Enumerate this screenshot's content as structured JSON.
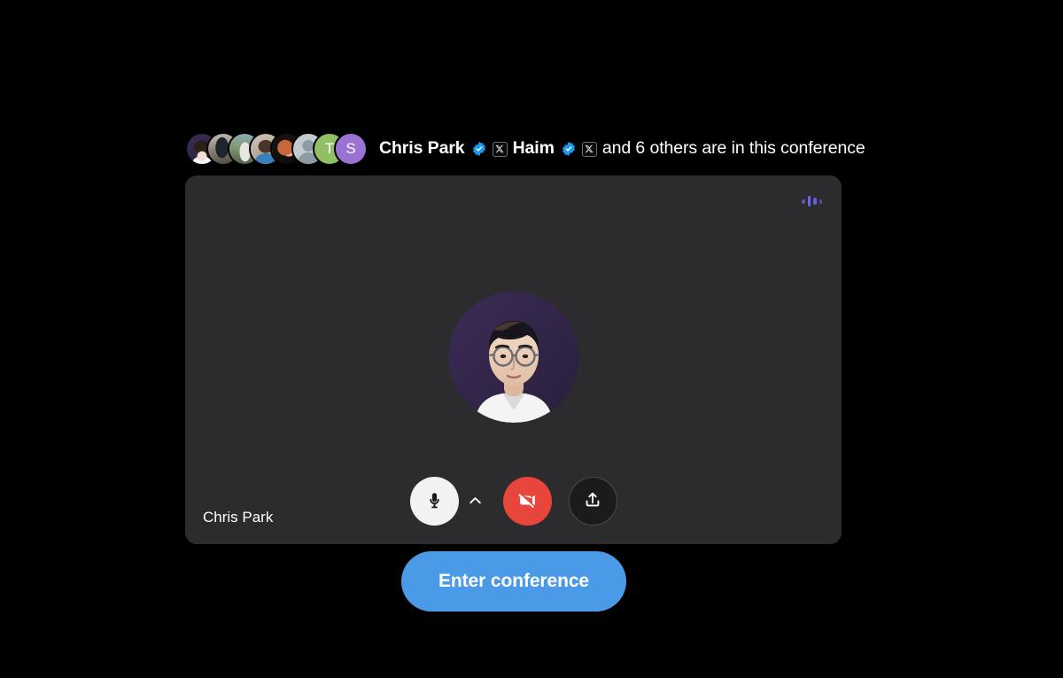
{
  "theme": {
    "background": "#000000",
    "panel_bg": "#2c2c2e",
    "accent_blue": "#4a9ae8",
    "verified_blue": "#1d9bf0",
    "danger_red": "#e8463c",
    "audio_indicator": "#6b66e8",
    "mic_button_bg": "#f2f2f2"
  },
  "header": {
    "participants": {
      "primary_name": "Chris Park",
      "secondary_name": "Haim",
      "others_text": "and 6 others are in this conference",
      "verified_badge_icon": "verified-check-icon",
      "x_badge_icon": "x-logo-icon"
    },
    "avatar_stack": [
      {
        "type": "photo",
        "name": "Chris Park",
        "style": "ph-chris",
        "initial": ""
      },
      {
        "type": "photo",
        "name": "participant-2",
        "style": "ph-bike",
        "initial": ""
      },
      {
        "type": "photo",
        "name": "participant-3",
        "style": "ph-land",
        "initial": ""
      },
      {
        "type": "photo",
        "name": "participant-4",
        "style": "ph-blue",
        "initial": ""
      },
      {
        "type": "photo",
        "name": "participant-5",
        "style": "ph-red",
        "initial": ""
      },
      {
        "type": "default",
        "name": "participant-6",
        "style": "av-default",
        "initial": ""
      },
      {
        "type": "initial",
        "name": "participant-7",
        "style": "av-initial-t",
        "initial": "T"
      },
      {
        "type": "initial",
        "name": "participant-8",
        "style": "av-initial-s",
        "initial": "S"
      }
    ]
  },
  "preview": {
    "self_name": "Chris Park",
    "self_avatar_icon": "user-portrait-photo",
    "audio_indicator_icon": "audio-level-icon",
    "controls": {
      "mic": {
        "icon": "microphone-icon",
        "label": "Microphone",
        "state": "on"
      },
      "mic_options": {
        "icon": "chevron-up-icon",
        "label": "Microphone options"
      },
      "camera": {
        "icon": "camera-off-icon",
        "label": "Camera off",
        "state": "off"
      },
      "share": {
        "icon": "share-upload-icon",
        "label": "Share screen"
      }
    }
  },
  "actions": {
    "enter_conference_label": "Enter conference"
  }
}
